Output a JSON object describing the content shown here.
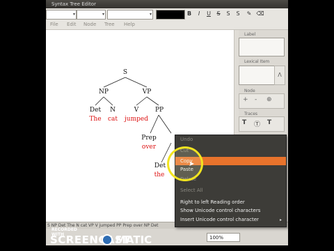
{
  "window": {
    "title": "Syntax Tree Editor"
  },
  "toolbar": {
    "bold": "B",
    "italic": "I",
    "underline": "U",
    "strike": "S",
    "sup": "S",
    "sub": "S",
    "color_swatch": "#000000"
  },
  "menubar": {
    "items": [
      "File",
      "Edit",
      "Node",
      "Tree",
      "Help"
    ]
  },
  "tree": {
    "nodes": [
      "S",
      "NP",
      "VP",
      "Det",
      "N",
      "V",
      "PP",
      "Prep",
      "Det"
    ],
    "leaves": [
      "The",
      "cat",
      "jumped",
      "over",
      "the"
    ]
  },
  "right_panel": {
    "label": "Label",
    "lexical_item": "Lexical Item",
    "node": "Node",
    "triangle_btn": "Λ",
    "node_icons": [
      "+",
      "-",
      "⊕"
    ],
    "traces": "Traces",
    "trace_icons": [
      "T",
      "Ⓣ",
      "T"
    ]
  },
  "context_menu": {
    "items": [
      "Undo",
      "Cut",
      "Copy",
      "Paste",
      "Delete",
      "Select All",
      "Right to left Reading order",
      "Show Unicode control characters",
      "Insert Unicode control character"
    ],
    "highlighted": "Copy"
  },
  "statusbar": {
    "text": "S NP Det The N cat VP V jumped PP Prep over NP Det"
  },
  "zoom": {
    "value": "100%"
  },
  "watermark": {
    "recorded": "RECORDED WITH",
    "brand_left": "SCREENCAST",
    "brand_right": "MATIC"
  },
  "colors": {
    "highlight": "#e8732c",
    "leaf_text": "#d11111",
    "menu_bg": "#3d3c38"
  }
}
